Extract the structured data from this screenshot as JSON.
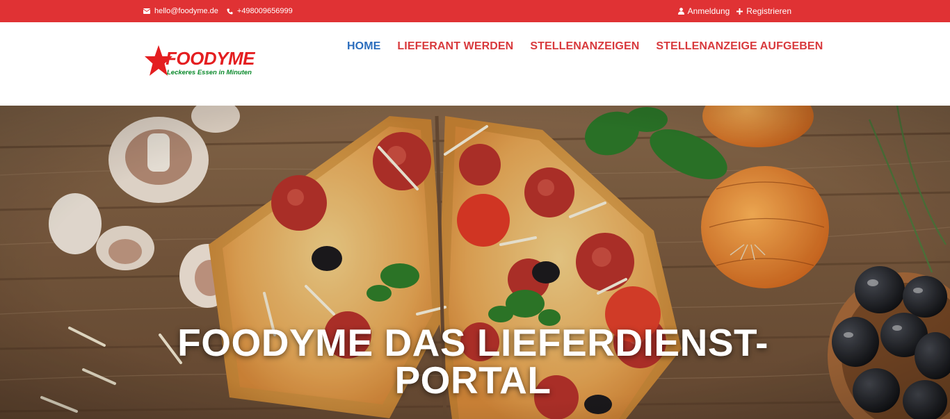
{
  "topbar": {
    "email": "hello@foodyme.de",
    "phone": "+498009656999",
    "login_label": "Anmeldung",
    "register_label": "Registrieren",
    "background": "#e03234"
  },
  "header": {
    "logo": {
      "brand": "FOODYME",
      "slogan": "Leckeres Essen in Minuten",
      "icon": "red-star-icon"
    },
    "nav": [
      {
        "label": "HOME",
        "active": true
      },
      {
        "label": "LIEFERANT WERDEN",
        "active": false
      },
      {
        "label": "STELLENANZEIGEN",
        "active": false
      },
      {
        "label": "STELLENANZEIGE AUFGEBEN",
        "active": false
      }
    ],
    "colors": {
      "nav_active": "#2b6dbd",
      "nav_default": "#d83a3d"
    }
  },
  "hero": {
    "title": "FOODYME DAS LIEFERDIENST-PORTAL",
    "image": "pizza-on-wooden-table"
  }
}
